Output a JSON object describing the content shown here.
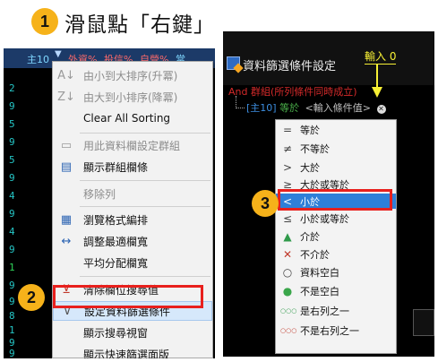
{
  "step1": {
    "number": "1",
    "text": "滑鼠點「右鍵」"
  },
  "step2": {
    "number": "2"
  },
  "step3": {
    "number": "3"
  },
  "left_panel": {
    "header_cells": [
      "主10",
      "外資%",
      "投信%",
      "自營%",
      "當"
    ],
    "row_numbers": [
      "2",
      "9",
      "5",
      "9",
      "5",
      "9",
      "4",
      "9",
      "4",
      "9",
      "1",
      "9",
      "9",
      "8",
      "1",
      "9",
      "9"
    ],
    "context_menu": {
      "items": [
        {
          "icon": "sort-ascending-icon",
          "label": "由小到大排序(升冪)",
          "disabled": true
        },
        {
          "icon": "sort-descending-icon",
          "label": "由大到小排序(降冪)",
          "disabled": true
        },
        {
          "icon": "",
          "label": "Clear All Sorting",
          "disabled": false
        },
        {
          "icon": "group-icon",
          "label": "用此資料欄設定群組",
          "disabled": true
        },
        {
          "icon": "group-panel-icon",
          "label": "顯示群組欄條",
          "disabled": false
        },
        {
          "icon": "",
          "label": "移除列",
          "disabled": true
        },
        {
          "icon": "format-icon",
          "label": "瀏覽格式編排",
          "disabled": false
        },
        {
          "icon": "fit-width-icon",
          "label": "調整最適欄寬",
          "disabled": false
        },
        {
          "icon": "",
          "label": "平均分配欄寬",
          "disabled": false
        },
        {
          "icon": "clear-filter-icon",
          "label": "清除欄位搜尋值",
          "disabled": false
        },
        {
          "icon": "filter-icon",
          "label": "設定資料篩選條件",
          "disabled": false,
          "selected": true
        },
        {
          "icon": "",
          "label": "顯示搜尋視窗",
          "disabled": false
        },
        {
          "icon": "",
          "label": "顯示快速篩選面版",
          "disabled": false
        }
      ]
    }
  },
  "right_panel": {
    "dialog_title": "資料篩選條件設定",
    "input_note": "輸入 0",
    "tree_root": "And 群組(所列條件同時成立)",
    "tree_node": {
      "field": "[主10]",
      "operator": "等於",
      "value": "<輸入條件值>"
    },
    "operators": [
      {
        "icon": "=",
        "label": "等於"
      },
      {
        "icon": "≠",
        "label": "不等於"
      },
      {
        "icon": ">",
        "label": "大於"
      },
      {
        "icon": "≥",
        "label": "大於或等於"
      },
      {
        "icon": "<",
        "label": "小於",
        "selected": true
      },
      {
        "icon": "≤",
        "label": "小於或等於"
      },
      {
        "icon": "▲",
        "label": "介於"
      },
      {
        "icon": "✕",
        "label": "不介於"
      },
      {
        "icon": "○",
        "label": "資料空白"
      },
      {
        "icon": "●",
        "label": "不是空白"
      },
      {
        "icon": "○○○",
        "label": "是右列之一"
      },
      {
        "icon": "○○○",
        "label": "不是右列之一"
      }
    ]
  },
  "colors": {
    "badge": "#f6b21a",
    "highlight": "#e8201d",
    "selection": "#2e7fd8",
    "note": "#f7f035"
  }
}
